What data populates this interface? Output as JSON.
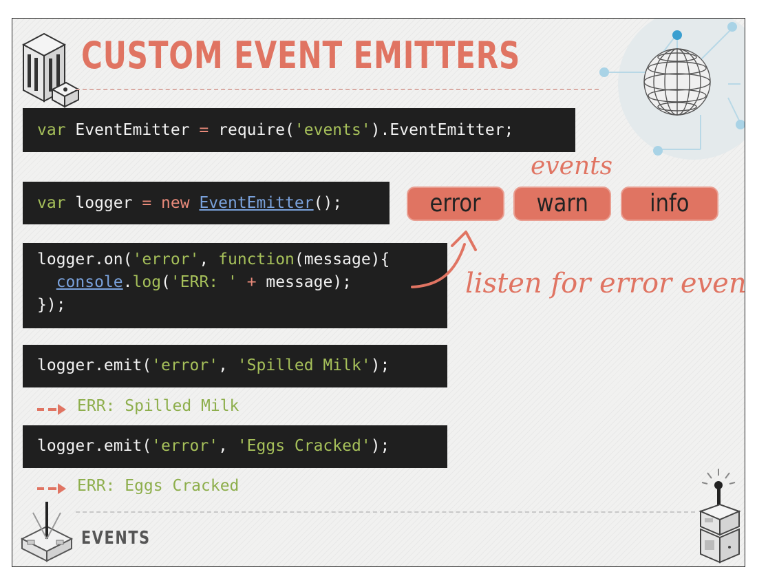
{
  "slide": {
    "title": "CUSTOM EVENT EMITTERS",
    "footer": "EVENTS"
  },
  "code_blocks": {
    "require": {
      "kw": "var",
      "name": " EventEmitter ",
      "op": "=",
      "call": " require(",
      "str": "'events'",
      "rest": ").EventEmitter;"
    },
    "new_logger": {
      "kw": "var",
      "name": " logger ",
      "op": "=",
      "new": " new",
      "space": " ",
      "cls": "EventEmitter",
      "rest": "();"
    },
    "listener": {
      "l1_a": "logger.on(",
      "l1_str": "'error'",
      "l1_b": ", ",
      "l1_fn": "function",
      "l1_c": "(message){",
      "l2_indent": "  ",
      "l2_cls": "console",
      "l2_a": ".",
      "l2_fn": "log",
      "l2_b": "(",
      "l2_str": "'ERR: '",
      "l2_c": " ",
      "l2_op": "+",
      "l2_d": " message);",
      "l3": "});"
    },
    "emit1": {
      "a": "logger.emit(",
      "s1": "'error'",
      "b": ", ",
      "s2": "'Spilled Milk'",
      "c": ");"
    },
    "emit2": {
      "a": "logger.emit(",
      "s1": "'error'",
      "b": ", ",
      "s2": "'Eggs Cracked'",
      "c": ");"
    }
  },
  "outputs": {
    "out1": "ERR: Spilled Milk",
    "out2": "ERR: Eggs Cracked"
  },
  "annotations": {
    "events_label": "events",
    "listen_label": "listen for error event"
  },
  "event_pills": [
    "error",
    "warn",
    "info"
  ],
  "colors": {
    "accent": "#e07462",
    "code_bg": "#1f1f1f",
    "string_green": "#a6c05a",
    "output_green": "#8dae4b",
    "class_blue": "#7aa2dc"
  },
  "icons": {
    "top_left": "server-building-icon",
    "top_right": "wireframe-globe-icon",
    "bottom_left": "antenna-box-icon",
    "bottom_right": "joystick-machine-icon"
  }
}
